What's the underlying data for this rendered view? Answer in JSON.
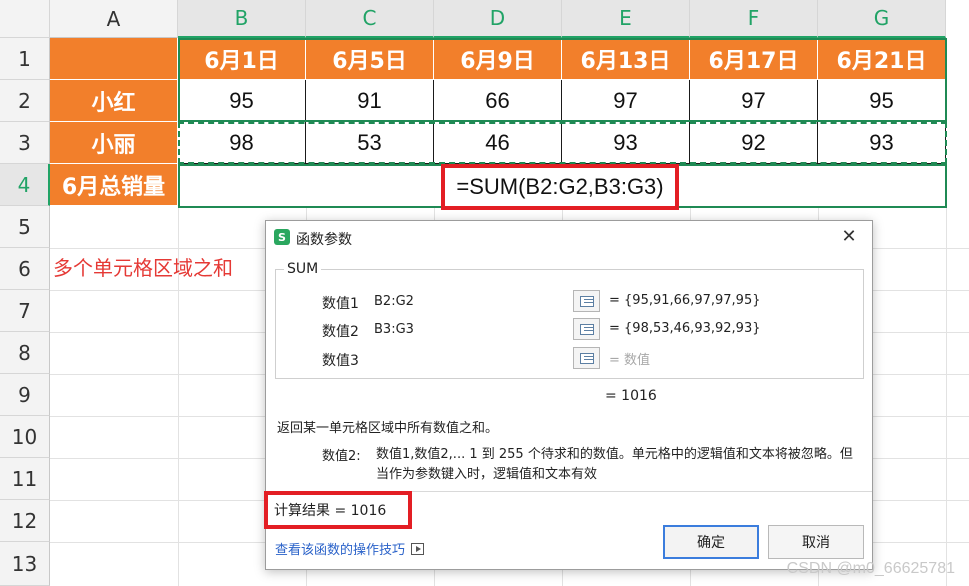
{
  "sheet": {
    "columns": [
      "A",
      "B",
      "C",
      "D",
      "E",
      "F",
      "G"
    ],
    "rows": [
      "1",
      "2",
      "3",
      "4",
      "5",
      "6",
      "7",
      "8",
      "9",
      "10",
      "11",
      "12",
      "13"
    ],
    "header_row": [
      "",
      "6月1日",
      "6月5日",
      "6月9日",
      "6月13日",
      "6月17日",
      "6月21日"
    ],
    "data_rows": [
      {
        "name": "小红",
        "values": [
          "95",
          "91",
          "66",
          "97",
          "97",
          "95"
        ]
      },
      {
        "name": "小丽",
        "values": [
          "98",
          "53",
          "46",
          "93",
          "92",
          "93"
        ]
      }
    ],
    "total_label": "6月总销量",
    "formula": "=SUM(B2:G2,B3:G3)",
    "annotation": "多个单元格区域之和",
    "colors": {
      "header_fill": "#f27f2b",
      "selection": "#1f8a54",
      "highlight": "#e31e24"
    }
  },
  "dialog": {
    "title": "函数参数",
    "app_icon": "S",
    "function_name": "SUM",
    "args": [
      {
        "label": "数值1",
        "value": "B2:G2",
        "placeholder": "",
        "result": "= {95,91,66,97,97,95}"
      },
      {
        "label": "数值2",
        "value": "B3:G3",
        "placeholder": "",
        "result": "= {98,53,46,93,92,93}"
      },
      {
        "label": "数值3",
        "value": "",
        "placeholder": "",
        "result": "= 数值"
      }
    ],
    "total": "= 1016",
    "description": "返回某一单元格区域中所有数值之和。",
    "arg_desc_label": "数值2:",
    "arg_desc": "数值1,数值2,... 1 到 255 个待求和的数值。单元格中的逻辑值和文本将被忽略。但当作为参数键入时，逻辑值和文本有效",
    "result": "计算结果 = 1016",
    "help_link": "查看该函数的操作技巧",
    "ok": "确定",
    "cancel": "取消"
  },
  "watermark": "CSDN @m0_66625781"
}
